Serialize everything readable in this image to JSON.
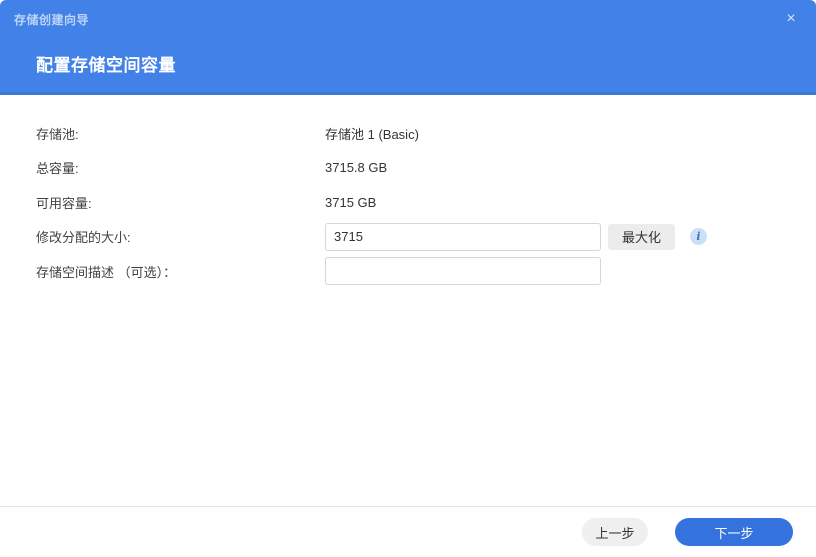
{
  "dialog": {
    "window_title": "存储创建向导",
    "close_glyph": "×",
    "step_title": "配置存储空间容量"
  },
  "form": {
    "static_rows": [
      {
        "label": "存储池:",
        "value": "存储池 1 (Basic)"
      },
      {
        "label": "总容量:",
        "value": "3715.8 GB"
      },
      {
        "label": "可用容量:",
        "value": "3715 GB"
      }
    ],
    "size_row": {
      "label": "修改分配的大小:",
      "input_value": "3715",
      "max_button_label": "最大化",
      "info_icon_glyph": "i"
    },
    "description_row": {
      "label": "存储空间描述 （可选）：",
      "input_value": ""
    }
  },
  "footer": {
    "back_label": "上一步",
    "next_label": "下一步"
  },
  "colors": {
    "header_blue": "#4181e8",
    "primary_button_blue": "#3472de",
    "secondary_button_gray": "#efefef",
    "max_button_gray": "#ececec",
    "info_icon_bg": "#cbdff6",
    "info_icon_fg": "#3e73c8"
  }
}
